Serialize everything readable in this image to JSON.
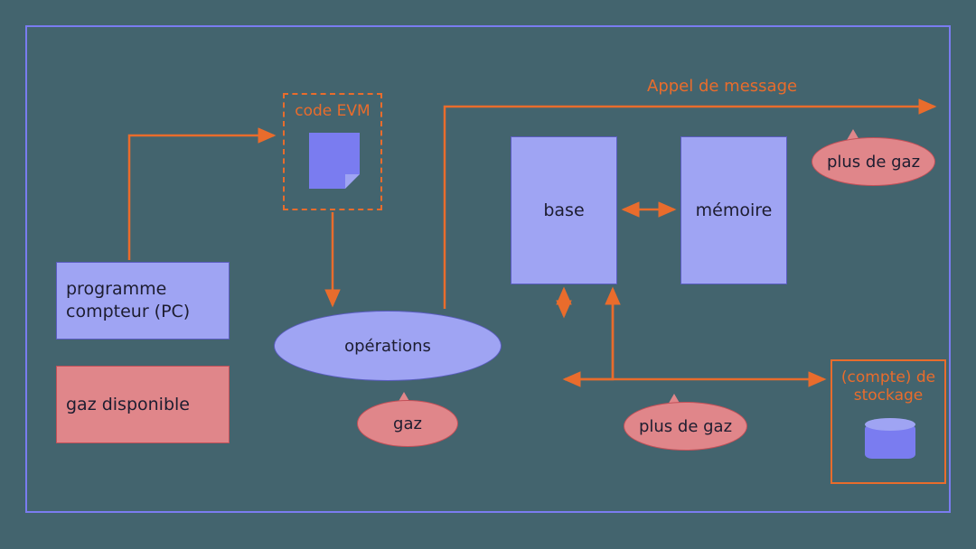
{
  "labels": {
    "program_counter": "programme compteur (PC)",
    "gas_available": "gaz disponible",
    "code_evm": "code EVM",
    "operations": "opérations",
    "gas": "gaz",
    "base": "base",
    "memory": "mémoire",
    "message_call": "Appel de message",
    "more_gas_top": "plus de gaz",
    "more_gas_bottom": "plus de gaz",
    "storage": "(compte) de stockage"
  }
}
